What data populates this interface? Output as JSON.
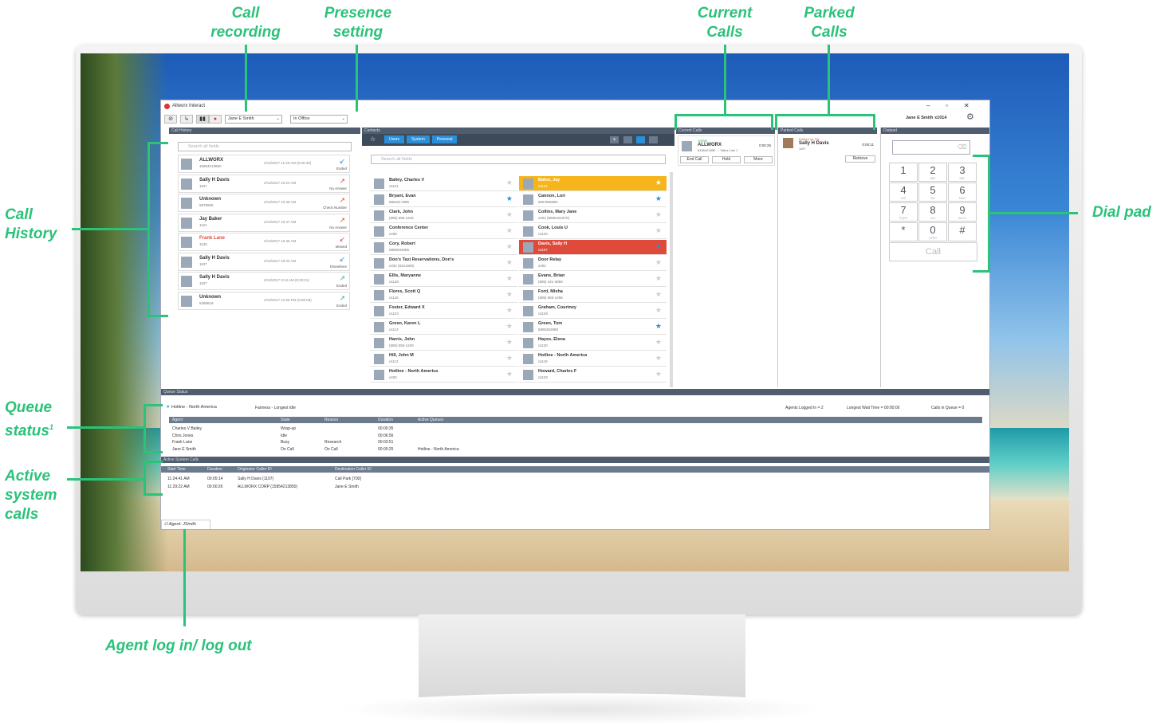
{
  "callouts": {
    "call_recording": "Call recording",
    "presence_setting": "Presence setting",
    "current_calls": "Current Calls",
    "parked_calls": "Parked Calls",
    "call_history": "Call History",
    "dial_pad": "Dial pad",
    "queue_status": "Queue status",
    "queue_status_sup": "1",
    "active_system_calls": "Active system calls",
    "agent_login": "Agent log in/ log out"
  },
  "app": {
    "title": "Allworx Interact",
    "user_select": "Jane E Smith",
    "presence": "In Office",
    "user_badge": "Jane E Smith",
    "user_ext": "x1014"
  },
  "call_history": {
    "header": "Call History",
    "search_placeholder": "Search all fields",
    "items": [
      {
        "name": "ALLWORX",
        "number": "15854213850",
        "date": "2/13/2017 11:26 AM (0:00:35)",
        "status": "Ended",
        "arrow": "↙",
        "arrow_color": "#2a8ed8",
        "name_color": "#333"
      },
      {
        "name": "Sally H Davis",
        "number": "1107",
        "date": "2/13/2017 10:24 AM",
        "status": "No Answer",
        "arrow": "↗",
        "arrow_color": "#e04a3a",
        "name_color": "#333"
      },
      {
        "name": "Unknown",
        "number": "5879955",
        "date": "2/13/2017 10:48 AM",
        "status": "Check Number",
        "arrow": "↗",
        "arrow_color": "#e04a3a",
        "name_color": "#333"
      },
      {
        "name": "Jay Baker",
        "number": "1121",
        "date": "2/13/2017 10:47 AM",
        "status": "No Answer",
        "arrow": "↗",
        "arrow_color": "#e04a3a",
        "name_color": "#333"
      },
      {
        "name": "Frank Lane",
        "number": "1133",
        "date": "2/13/2017 10:46 AM",
        "status": "Missed",
        "arrow": "↙",
        "arrow_color": "#e04a3a",
        "name_color": "#e04a3a"
      },
      {
        "name": "Sally H Davis",
        "number": "1107",
        "date": "2/13/2017 10:43 AM",
        "status": "Elsewhere",
        "arrow": "↙",
        "arrow_color": "#2a8ed8",
        "name_color": "#333"
      },
      {
        "name": "Sally H Davis",
        "number": "1107",
        "date": "2/13/2017 9:13 AM (0:00:01)",
        "status": "Ended",
        "arrow": "↗",
        "arrow_color": "#2bb56a",
        "name_color": "#333"
      },
      {
        "name": "Unknown",
        "number": "5458619",
        "date": "2/10/2017 12:08 PM (0:00:08)",
        "status": "Ended",
        "arrow": "↗",
        "arrow_color": "#2bb56a",
        "name_color": "#333"
      }
    ]
  },
  "contacts": {
    "header": "Contacts",
    "tabs": [
      "Users",
      "System",
      "Personal"
    ],
    "search_placeholder": "Search all fields",
    "left": [
      {
        "name": "Bailey, Charles V",
        "ext": "x1121",
        "bg": "#fff",
        "star_color": "#ccc"
      },
      {
        "name": "Bryant, Evan",
        "ext": "5854217896",
        "bg": "#fff",
        "star_color": "#2a8ed8"
      },
      {
        "name": "Clark, John",
        "ext": "(585) 555-1232",
        "bg": "#fff",
        "star_color": "#ccc"
      },
      {
        "name": "Conference Center",
        "ext": "x408",
        "bg": "#fff",
        "star_color": "#ccc"
      },
      {
        "name": "Cory, Robert",
        "ext": "5856934586",
        "bg": "#fff",
        "star_color": "#ccc"
      },
      {
        "name": "Don's Taxi Reservations, Don's",
        "ext": "x332 (8421550)",
        "bg": "#fff",
        "star_color": "#ccc"
      },
      {
        "name": "Ellis, Maryanne",
        "ext": "x1128",
        "bg": "#fff",
        "star_color": "#ccc"
      },
      {
        "name": "Flores, Scott Q",
        "ext": "x1116",
        "bg": "#fff",
        "star_color": "#ccc"
      },
      {
        "name": "Foster, Edward X",
        "ext": "x1123",
        "bg": "#fff",
        "star_color": "#ccc"
      },
      {
        "name": "Green, Karen L",
        "ext": "x1113",
        "bg": "#fff",
        "star_color": "#ccc"
      },
      {
        "name": "Harris, John",
        "ext": "(585) 555-1240",
        "bg": "#fff",
        "star_color": "#ccc"
      },
      {
        "name": "Hill, John M",
        "ext": "x1112",
        "bg": "#fff",
        "star_color": "#ccc"
      },
      {
        "name": "Hotline - North America",
        "ext": "x402",
        "bg": "#fff",
        "star_color": "#ccc"
      }
    ],
    "right": [
      {
        "name": "Baker, Jay",
        "ext": "x1121",
        "bg": "#f6b51a",
        "star_color": "#fff"
      },
      {
        "name": "Cannon, Lori",
        "ext": "5557890891",
        "bg": "#fff",
        "star_color": "#2a8ed8"
      },
      {
        "name": "Collins, Mary Jane",
        "ext": "x202 (8585421870)",
        "bg": "#fff",
        "star_color": "#ccc"
      },
      {
        "name": "Cook, Louis U",
        "ext": "x1120",
        "bg": "#fff",
        "star_color": "#ccc"
      },
      {
        "name": "Davis, Sally H",
        "ext": "x1107",
        "bg": "#e04a3a",
        "star_color": "#2a8ed8"
      },
      {
        "name": "Door Relay",
        "ext": "x402",
        "bg": "#fff",
        "star_color": "#ccc"
      },
      {
        "name": "Evans, Brian",
        "ext": "(585) 421-3850",
        "bg": "#fff",
        "star_color": "#ccc"
      },
      {
        "name": "Ford, Misha",
        "ext": "(585) 555-1255",
        "bg": "#fff",
        "star_color": "#ccc"
      },
      {
        "name": "Graham, Courtney",
        "ext": "x1129",
        "bg": "#fff",
        "star_color": "#ccc"
      },
      {
        "name": "Green, Tom",
        "ext": "5856262888",
        "bg": "#fff",
        "star_color": "#2a8ed8"
      },
      {
        "name": "Hayes, Elena",
        "ext": "x1130",
        "bg": "#fff",
        "star_color": "#ccc"
      },
      {
        "name": "Hotline - North America",
        "ext": "x1119",
        "bg": "#fff",
        "star_color": "#ccc"
      },
      {
        "name": "Howard, Charles F",
        "ext": "x1103",
        "bg": "#fff",
        "star_color": "#ccc"
      }
    ]
  },
  "current_calls": {
    "header": "Current Calls",
    "status": "Active",
    "name": "ALLWORX",
    "detail": "8185421850 → Sales Line 1",
    "time": "0:00:26",
    "buttons": [
      "End Call",
      "Hold",
      "More"
    ]
  },
  "parked_calls": {
    "header": "Parked Calls",
    "parked_on": "Parked on 701",
    "name": "Sally H Davis",
    "ext": "1107",
    "time": "0:00:11",
    "button": "Retrieve"
  },
  "dialpad": {
    "header": "Dialpad",
    "keys": [
      {
        "d": "1",
        "s": ""
      },
      {
        "d": "2",
        "s": "ABC"
      },
      {
        "d": "3",
        "s": "DEF"
      },
      {
        "d": "4",
        "s": "GHI"
      },
      {
        "d": "5",
        "s": "JKL"
      },
      {
        "d": "6",
        "s": "MNO"
      },
      {
        "d": "7",
        "s": "PQRS"
      },
      {
        "d": "8",
        "s": "TUV"
      },
      {
        "d": "9",
        "s": "WXYZ"
      },
      {
        "d": "*",
        "s": ""
      },
      {
        "d": "0",
        "s": "OPER"
      },
      {
        "d": "#",
        "s": ""
      }
    ],
    "call_button": "Call"
  },
  "queue_status": {
    "header": "Queue Status",
    "queue_name": "Hotline - North America",
    "fairness": "Fairness - Longest Idle",
    "agents_logged": "Agents Logged In = 2",
    "longest_wait": "Longest Wait Time = 00:00:00",
    "calls_in_queue": "Calls in Queue = 0",
    "columns": [
      "Agent",
      "State",
      "Reason",
      "Duration",
      "Active Queues"
    ],
    "rows": [
      [
        "Charles V Bailey",
        "Wrap-up",
        "",
        "00:00:35",
        ""
      ],
      [
        "Chris Jones",
        "Idle",
        "",
        "00:06:56",
        ""
      ],
      [
        "Frank Lane",
        "Busy",
        "Research",
        "00:03:51",
        ""
      ],
      [
        "Jane E Smith",
        "On Call",
        "On Call",
        "00:00:25",
        "Hotline - North America"
      ]
    ]
  },
  "active_calls": {
    "header": "Active System Calls",
    "columns": [
      "Start Time",
      "Duration",
      "Originator Caller ID",
      "Destination Caller ID"
    ],
    "rows": [
      [
        "11:24:41 AM",
        "00:05:14",
        "Sally H Davis (1107)",
        "Call Park [700]"
      ],
      [
        "11:29:22 AM",
        "00:00:26",
        "ALLWORX CORP (15854213850)",
        "Jane E Smith"
      ]
    ]
  },
  "agent_tab": "Agent: JSmith"
}
